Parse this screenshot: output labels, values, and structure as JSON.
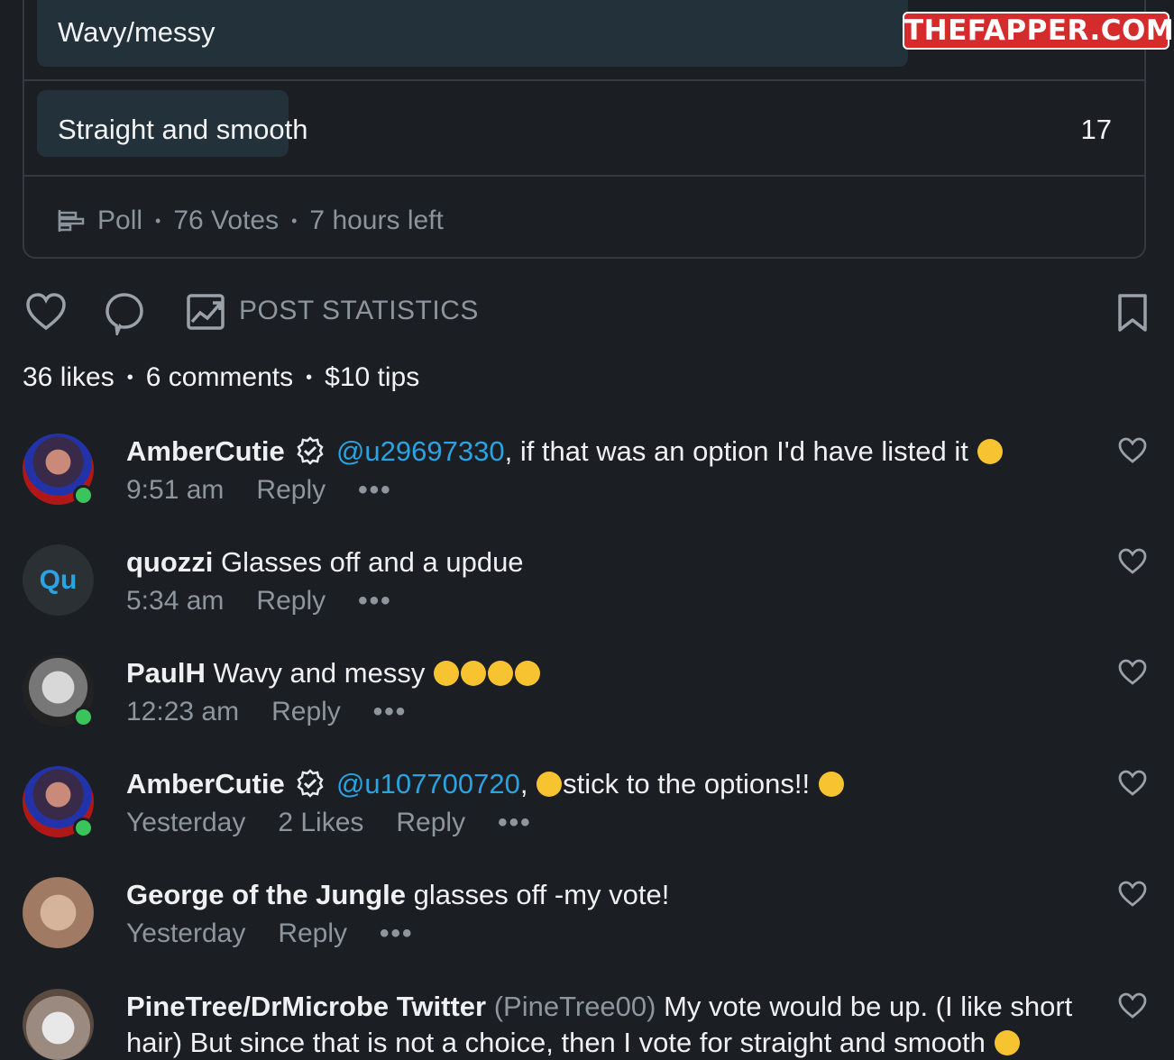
{
  "poll": {
    "options": [
      {
        "label": "Wavy/messy",
        "count": ""
      },
      {
        "label": "Straight and smooth",
        "count": "17"
      }
    ],
    "meta": {
      "type": "Poll",
      "votes": "76 Votes",
      "time_left": "7 hours left"
    }
  },
  "actions": {
    "statistics_label": "POST STATISTICS"
  },
  "summary": {
    "likes": "36 likes",
    "comments": "6 comments",
    "tips": "$10 tips"
  },
  "comments": [
    {
      "author": "AmberCutie",
      "verified": true,
      "mention": "@u29697330",
      "text": ", if that was an option I'd have listed it",
      "time": "9:51 am",
      "likes": "",
      "reply": "Reply",
      "online": true
    },
    {
      "author": "quozzi",
      "initials": "Qu",
      "text": "Glasses off and a updue",
      "time": "5:34 am",
      "reply": "Reply",
      "online": false
    },
    {
      "author": "PaulH",
      "text": "Wavy and messy",
      "time": "12:23 am",
      "reply": "Reply",
      "online": true
    },
    {
      "author": "AmberCutie",
      "verified": true,
      "mention": "@u107700720",
      "text_a": ",",
      "text_b": "stick to the options!!",
      "time": "Yesterday",
      "likes": "2 Likes",
      "reply": "Reply",
      "online": true
    },
    {
      "author": "George of the Jungle",
      "text": "glasses off -my vote!",
      "time": "Yesterday",
      "reply": "Reply",
      "online": false
    },
    {
      "author": "PineTree/DrMicrobe Twitter",
      "handle": "(PineTree00)",
      "text": "My vote would be up. (I like short",
      "text_2": "hair) But since that is not a choice, then I vote for straight and smooth"
    }
  ],
  "more_label": "•••",
  "watermark": "THEFAPPER.COM",
  "colors": {
    "background": "#1b1e22",
    "mention": "#2aa3e0",
    "online": "#3ac45b",
    "poll_bar": "#23313a"
  }
}
